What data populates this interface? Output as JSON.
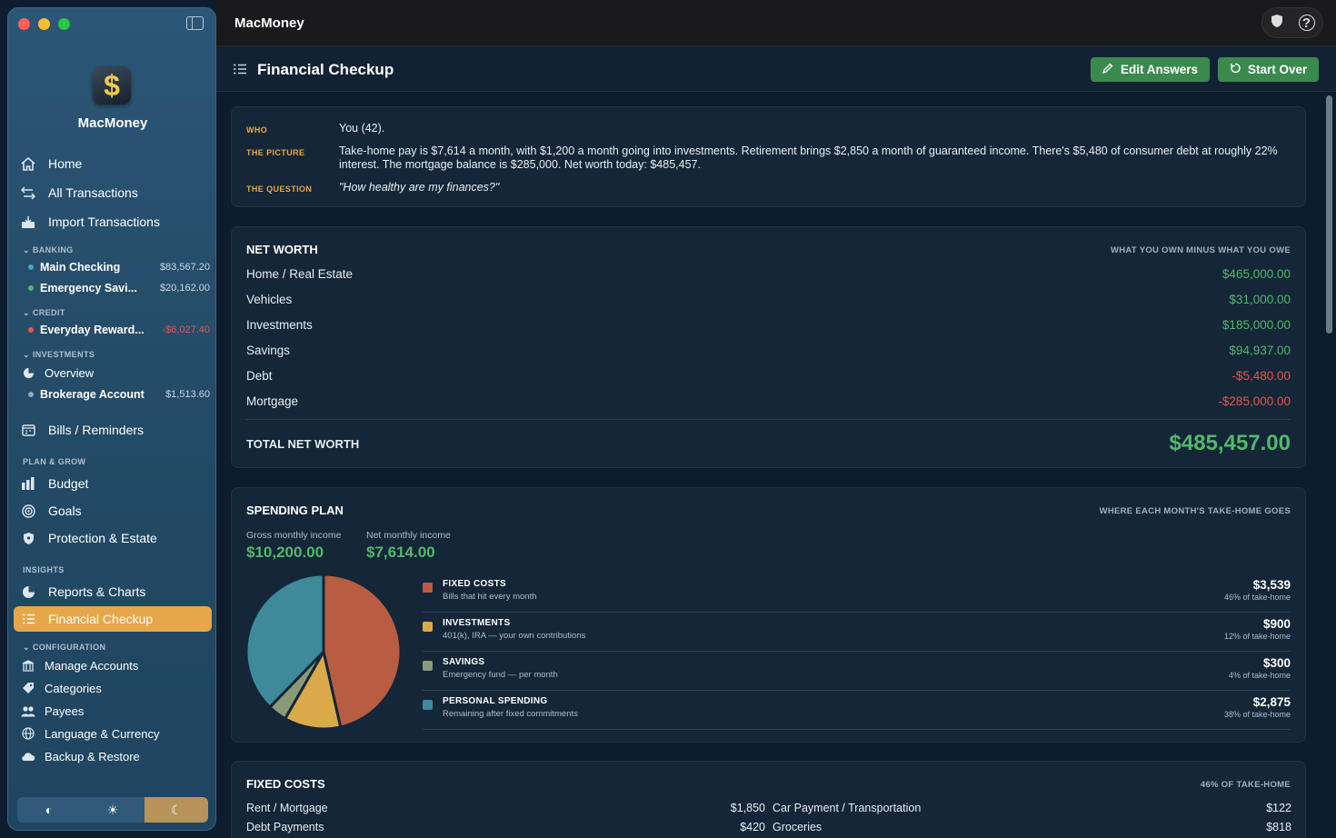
{
  "app": {
    "name": "MacMoney",
    "window_title": "MacMoney"
  },
  "sidebar": {
    "app_name": "MacMoney",
    "top_items": [
      {
        "label": "Home",
        "icon": "house-icon"
      },
      {
        "label": "All Transactions",
        "icon": "arrows-icon"
      },
      {
        "label": "Import Transactions",
        "icon": "import-icon"
      }
    ],
    "banking": {
      "title": "BANKING",
      "accounts": [
        {
          "name": "Main Checking",
          "amount": "$83,567.20",
          "color": "#4aa3c8"
        },
        {
          "name": "Emergency Savi...",
          "amount": "$20,162.00",
          "color": "#52b86a"
        }
      ]
    },
    "credit": {
      "title": "CREDIT",
      "accounts": [
        {
          "name": "Everyday Reward...",
          "amount": "-$6,027.40",
          "color": "#e05a4f"
        }
      ]
    },
    "investments": {
      "title": "INVESTMENTS",
      "overview": "Overview",
      "accounts": [
        {
          "name": "Brokerage Account",
          "amount": "$1,513.60",
          "color": "#9aa8b4"
        }
      ]
    },
    "bills": "Bills / Reminders",
    "plan_title": "PLAN & GROW",
    "plan_items": [
      "Budget",
      "Goals",
      "Protection & Estate"
    ],
    "insights_title": "INSIGHTS",
    "insights_items": [
      "Reports & Charts",
      "Financial Checkup"
    ],
    "config_title": "CONFIGURATION",
    "config_items": [
      "Manage Accounts",
      "Categories",
      "Payees",
      "Language & Currency",
      "Backup & Restore"
    ]
  },
  "header": {
    "title": "Financial Checkup",
    "edit_label": "Edit Answers",
    "start_label": "Start Over"
  },
  "profile": {
    "who_label": "WHO",
    "who": "You (42).",
    "picture_label": "THE PICTURE",
    "picture": "Take-home pay is $7,614 a month, with $1,200 a month going into investments. Retirement brings $2,850 a month of guaranteed income. There's $5,480 of consumer debt at roughly 22% interest. The mortgage balance is $285,000. Net worth today: $485,457.",
    "question_label": "THE QUESTION",
    "question": "\"How healthy are my finances?\""
  },
  "net_worth": {
    "title": "NET WORTH",
    "subtitle": "WHAT YOU OWN MINUS WHAT YOU OWE",
    "rows": [
      {
        "label": "Home / Real Estate",
        "value": "$465,000.00",
        "sign": "pos"
      },
      {
        "label": "Vehicles",
        "value": "$31,000.00",
        "sign": "pos"
      },
      {
        "label": "Investments",
        "value": "$185,000.00",
        "sign": "pos"
      },
      {
        "label": "Savings",
        "value": "$94,937.00",
        "sign": "pos"
      },
      {
        "label": "Debt",
        "value": "-$5,480.00",
        "sign": "neg"
      },
      {
        "label": "Mortgage",
        "value": "-$285,000.00",
        "sign": "neg"
      }
    ],
    "total_label": "TOTAL NET WORTH",
    "total_value": "$485,457.00"
  },
  "spending": {
    "title": "SPENDING PLAN",
    "subtitle": "WHERE EACH MONTH'S TAKE-HOME GOES",
    "gross_label": "Gross monthly income",
    "gross": "$10,200.00",
    "net_label": "Net monthly income",
    "net": "$7,614.00",
    "items": [
      {
        "name": "FIXED COSTS",
        "desc": "Bills that hit every month",
        "amount": "$3,539",
        "pct_label": "46% of take-home",
        "color": "#b85c42"
      },
      {
        "name": "INVESTMENTS",
        "desc": "401(k), IRA — your own contributions",
        "amount": "$900",
        "pct_label": "12% of take-home",
        "color": "#d9aa4a"
      },
      {
        "name": "SAVINGS",
        "desc": "Emergency fund — per month",
        "amount": "$300",
        "pct_label": "4% of take-home",
        "color": "#8a9a78"
      },
      {
        "name": "PERSONAL SPENDING",
        "desc": "Remaining after fixed commitments",
        "amount": "$2,875",
        "pct_label": "38% of take-home",
        "color": "#3f8a9a"
      }
    ]
  },
  "chart_data": {
    "type": "pie",
    "categories": [
      "FIXED COSTS",
      "INVESTMENTS",
      "SAVINGS",
      "PERSONAL SPENDING"
    ],
    "values": [
      3539,
      900,
      300,
      2875
    ],
    "colors": [
      "#b85c42",
      "#d9aa4a",
      "#8a9a78",
      "#3f8a9a"
    ]
  },
  "fixed_costs": {
    "title": "FIXED COSTS",
    "subtitle": "46% OF TAKE-HOME",
    "left": [
      {
        "label": "Rent / Mortgage",
        "value": "$1,850"
      },
      {
        "label": "Debt Payments",
        "value": "$420"
      }
    ],
    "right": [
      {
        "label": "Car Payment / Transportation",
        "value": "$122"
      },
      {
        "label": "Groceries",
        "value": "$818"
      }
    ]
  }
}
